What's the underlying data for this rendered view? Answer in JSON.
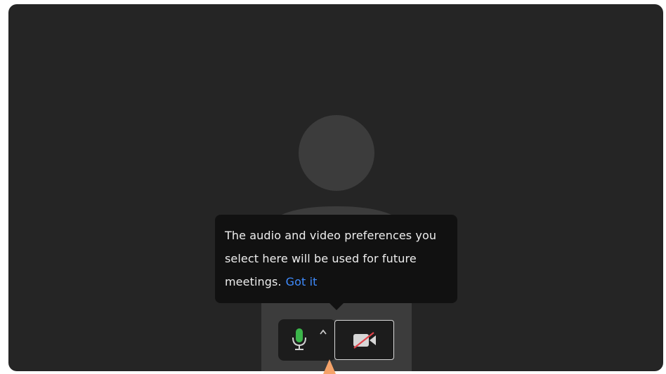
{
  "tooltip": {
    "message": "The audio and video preferences you select here will be used for future meetings.",
    "link_label": "Got it"
  },
  "controls": {
    "mic": {
      "icon": "microphone-icon",
      "state": "unmuted",
      "color": "#3bb54a"
    },
    "audio_options": {
      "icon": "chevron-up-icon"
    },
    "video": {
      "icon": "video-off-icon",
      "state": "off",
      "slash_color": "#e0434a"
    }
  },
  "colors": {
    "background": "#252525",
    "tooltip": "#111111",
    "link": "#3f8cff"
  }
}
